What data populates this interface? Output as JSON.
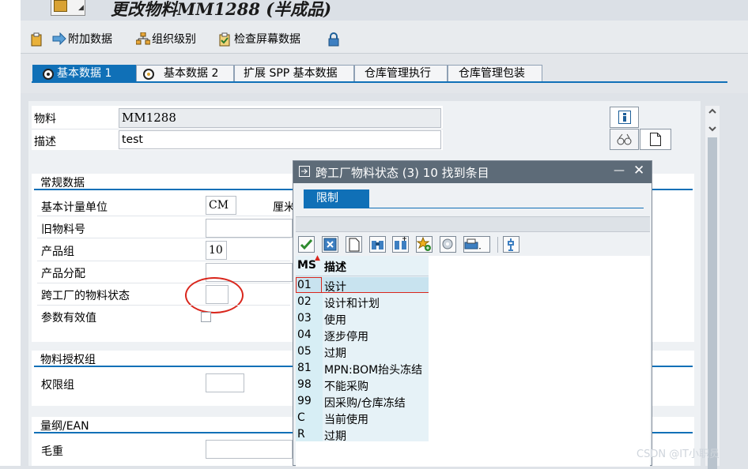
{
  "window": {
    "title": "更改物料MM1288 (半成品)"
  },
  "toolbar": {
    "items": [
      {
        "label": "附加数据"
      },
      {
        "label": "组织级别"
      },
      {
        "label": "检查屏幕数据"
      }
    ]
  },
  "tabs": [
    {
      "label": "基本数据 1",
      "active": true
    },
    {
      "label": "基本数据 2"
    },
    {
      "label": "扩展 SPP 基本数据"
    },
    {
      "label": "仓库管理执行"
    },
    {
      "label": "仓库管理包装"
    }
  ],
  "header": {
    "material_label": "物料",
    "material_value": "MM1288",
    "desc_label": "描述",
    "desc_value": "test"
  },
  "general": {
    "title": "常规数据",
    "base_uom_label": "基本计量单位",
    "base_uom_value": "CM",
    "base_uom_text": "厘米",
    "old_mat_label": "旧物料号",
    "mat_group_label": "产品组",
    "mat_group_value": "10",
    "prod_alloc_label": "产品分配",
    "x_plant_status_label": "跨工厂的物料状态",
    "param_eff_label": "参数有效值"
  },
  "authorization": {
    "title": "物料授权组",
    "auth_group_label": "权限组"
  },
  "dimensions": {
    "title": "量纲/EAN",
    "gross_weight_label": "毛重"
  },
  "popup": {
    "title": "跨工厂物料状态 (3)   10 找到条目",
    "restrict_tab": "限制",
    "col_ms": "MS",
    "col_desc": "描述",
    "rows": [
      {
        "ms": "01",
        "desc": "设计"
      },
      {
        "ms": "02",
        "desc": "设计和计划"
      },
      {
        "ms": "03",
        "desc": "使用"
      },
      {
        "ms": "04",
        "desc": "逐步停用"
      },
      {
        "ms": "05",
        "desc": "过期"
      },
      {
        "ms": "81",
        "desc": "MPN:BOM抬头冻结"
      },
      {
        "ms": "98",
        "desc": "不能采购"
      },
      {
        "ms": "99",
        "desc": "因采购/仓库冻结"
      },
      {
        "ms": "C",
        "desc": "当前使用"
      },
      {
        "ms": "R",
        "desc": "过期"
      }
    ]
  },
  "watermark": "CSDN @IT小职员",
  "colors": {
    "accent": "#1070b7",
    "popup_header": "#5d6b78",
    "highlight_circle": "#d9261c"
  }
}
